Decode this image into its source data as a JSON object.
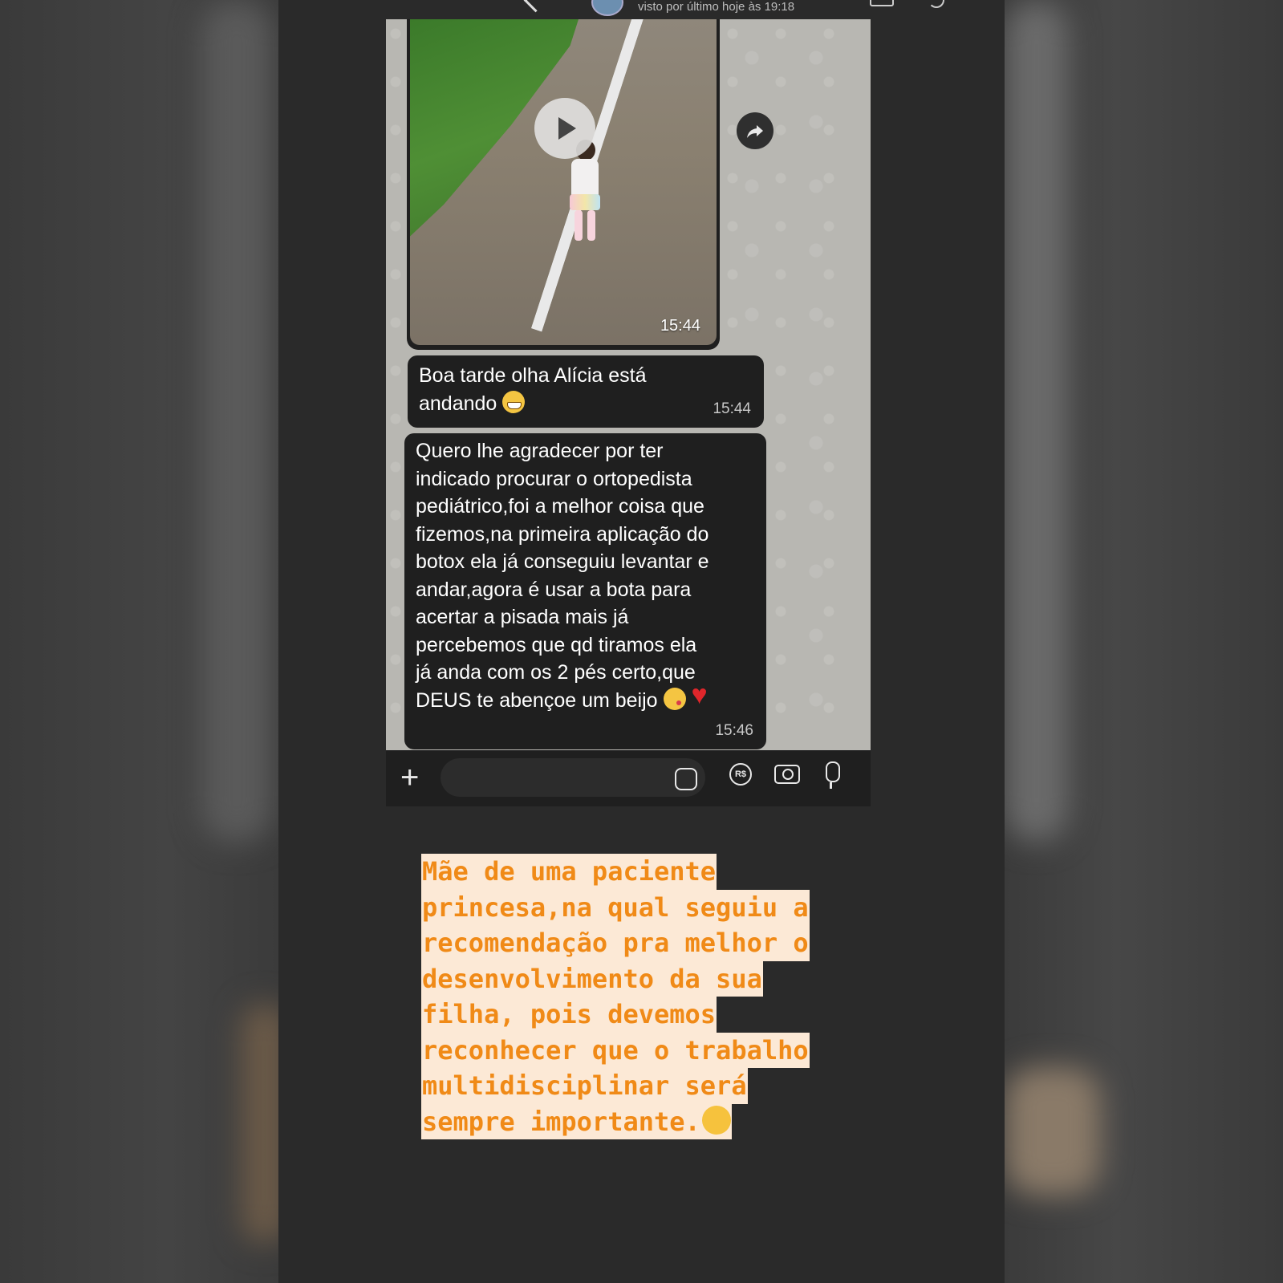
{
  "header": {
    "status": "visto por último hoje às 19:18"
  },
  "video_message": {
    "time": "15:44"
  },
  "messages": [
    {
      "lines": [
        "Boa tarde olha Alícia está",
        "andando"
      ],
      "emoji": [
        "grinning-face"
      ],
      "time": "15:44"
    },
    {
      "lines": [
        "Quero lhe agradecer por ter",
        "indicado procurar o ortopedista",
        "pediátrico,foi a melhor coisa que",
        "fizemos,na primeira aplicação do",
        "botox ela já conseguiu levantar e",
        "andar,agora é usar a bota para",
        "acertar a pisada mais já",
        "percebemos que qd tiramos ela",
        "já anda com os 2 pés certo,que",
        "DEUS te abençoe um beijo"
      ],
      "emoji": [
        "face-blowing-kiss",
        "red-heart"
      ],
      "time": "15:46"
    }
  ],
  "input_bar": {
    "icons": [
      "plus-icon",
      "sticker-icon",
      "payment-rs-icon",
      "camera-icon",
      "microphone-icon"
    ],
    "rs_label": "R$"
  },
  "caption": {
    "lines": [
      "Mãe de uma paciente",
      "princesa,na qual seguiu a",
      "recomendação pra melhor o",
      "desenvolvimento da sua",
      "filha, pois devemos",
      "reconhecer que o trabalho",
      "multidisciplinar será",
      "sempre importante."
    ],
    "emoji": "smiling-face"
  },
  "colors": {
    "caption_text": "#f08a17",
    "caption_highlight": "#fce9d6",
    "bubble": "#1f1f1f",
    "chat_background": "#b8b7b2"
  }
}
